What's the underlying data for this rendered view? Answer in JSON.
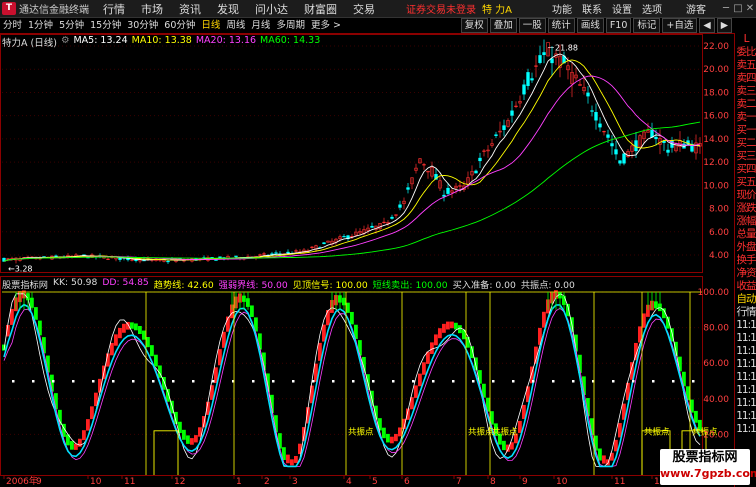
{
  "app": {
    "title": "通达信金融终端",
    "logo": "T"
  },
  "menu": [
    "行情",
    "市场",
    "资讯",
    "发现",
    "问小达",
    "财富圈",
    "交易"
  ],
  "menubar_right": {
    "warning": "证券交易未登录",
    "stock": "特 力A",
    "items": [
      "功能",
      "联系",
      "设置",
      "选项"
    ],
    "guest": "游客",
    "controls": [
      "─",
      "□",
      "✕"
    ]
  },
  "toolbar": {
    "periods": [
      "分时",
      "1分钟",
      "5分钟",
      "15分钟",
      "30分钟",
      "60分钟",
      "日线",
      "周线",
      "月线",
      "多周期",
      "更多 >"
    ],
    "active": "日线",
    "right": [
      "复权",
      "叠加",
      "一股",
      "统计",
      "画线",
      "F10",
      "标记",
      "+自选"
    ],
    "nav": [
      "◀",
      "▶"
    ]
  },
  "ma": {
    "name": "特力A (日线)",
    "ma5": "MA5: 13.24",
    "ma10": "MA10: 13.38",
    "ma20": "MA20: 13.16",
    "ma60": "MA60: 14.33",
    "colors": {
      "name": "#dddddd",
      "ma5": "#ffffff",
      "ma10": "#ffff00",
      "ma20": "#ff40ff",
      "ma60": "#00ff00"
    }
  },
  "price_axis": [
    "22.00",
    "20.00",
    "18.00",
    "16.00",
    "14.00",
    "12.00",
    "10.00",
    "8.00",
    "6.00",
    "4.00"
  ],
  "annotations": {
    "high": "21.88",
    "low": "3.28"
  },
  "indicator": {
    "items": [
      {
        "label": "股票指标网",
        "color": "#dddddd"
      },
      {
        "label": "KK: 50.98",
        "color": "#dddddd"
      },
      {
        "label": "DD: 54.85",
        "color": "#ff40ff"
      },
      {
        "label": "趋势线: 42.60",
        "color": "#ffff00"
      },
      {
        "label": "强弱界线: 50.00",
        "color": "#ff40ff"
      },
      {
        "label": "见顶信号: 100.00",
        "color": "#ffff00"
      },
      {
        "label": "短线卖出: 100.00",
        "color": "#00ff00"
      },
      {
        "label": "买入准备: 0.00",
        "color": "#dddddd"
      },
      {
        "label": "共振点: 0.00",
        "color": "#dddddd"
      }
    ],
    "axis": [
      "100.00",
      "80.00",
      "60.00",
      "40.00",
      "20.00"
    ],
    "marker_label": "共振点"
  },
  "date_axis": [
    "2006年",
    "9",
    "10",
    "11",
    "12",
    "1",
    "2",
    "3",
    "4",
    "5",
    "6",
    "7",
    "8",
    "9",
    "10",
    "11",
    "12"
  ],
  "right_panel": [
    {
      "t": "L",
      "c": "r"
    },
    {
      "t": "委比",
      "c": "r"
    },
    {
      "t": "卖五",
      "c": "r"
    },
    {
      "t": "卖四",
      "c": "r"
    },
    {
      "t": "卖三",
      "c": "r"
    },
    {
      "t": "卖二",
      "c": "r"
    },
    {
      "t": "卖一",
      "c": "r"
    },
    {
      "t": "买一",
      "c": "r"
    },
    {
      "t": "买二",
      "c": "r"
    },
    {
      "t": "买三",
      "c": "r"
    },
    {
      "t": "买四",
      "c": "r"
    },
    {
      "t": "买五",
      "c": "r"
    },
    {
      "t": "现价",
      "c": "r"
    },
    {
      "t": "涨跌",
      "c": "r"
    },
    {
      "t": "涨幅",
      "c": "r"
    },
    {
      "t": "总量",
      "c": "r"
    },
    {
      "t": "外盘",
      "c": "r"
    },
    {
      "t": "换手",
      "c": "r"
    },
    {
      "t": "净资",
      "c": "r"
    },
    {
      "t": "收益",
      "c": "r"
    },
    {
      "t": "自动",
      "c": "y"
    },
    {
      "t": "行情",
      "c": "w"
    },
    {
      "t": "11:1",
      "c": "w"
    },
    {
      "t": "11:1",
      "c": "w"
    },
    {
      "t": "11:1",
      "c": "w"
    },
    {
      "t": "11:1",
      "c": "w"
    },
    {
      "t": "11:1",
      "c": "w"
    },
    {
      "t": "11:1",
      "c": "w"
    },
    {
      "t": "11:1",
      "c": "w"
    },
    {
      "t": "11:1",
      "c": "w"
    },
    {
      "t": "11:1",
      "c": "w"
    }
  ],
  "watermark": {
    "line1": "股票指标网",
    "line2": "www.7gpzb.com"
  }
}
